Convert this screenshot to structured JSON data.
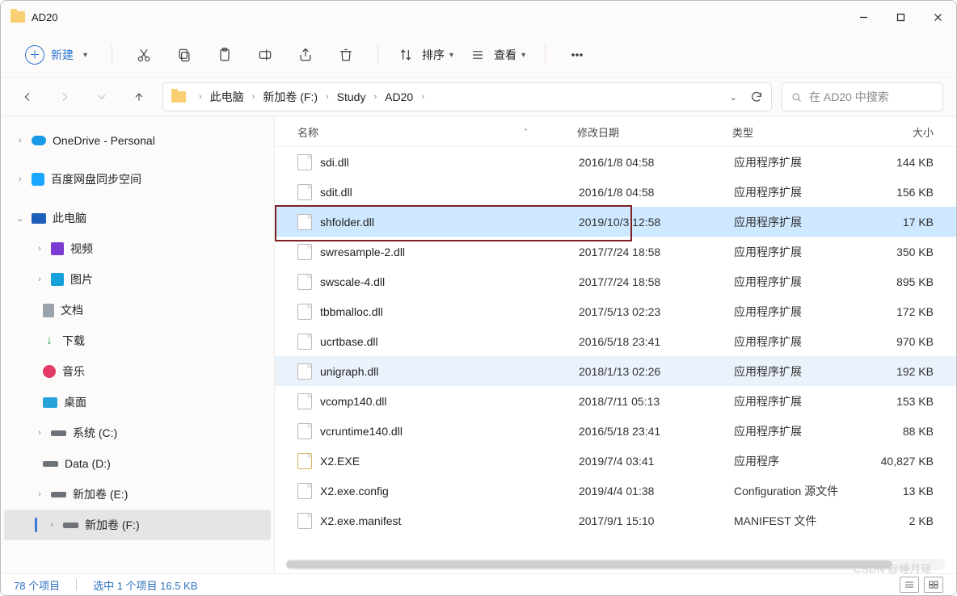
{
  "window": {
    "title": "AD20"
  },
  "toolbar": {
    "new_label": "新建",
    "sort_label": "排序",
    "view_label": "查看"
  },
  "breadcrumb": {
    "items": [
      "此电脑",
      "新加卷 (F:)",
      "Study",
      "AD20"
    ]
  },
  "search": {
    "placeholder": "在 AD20 中搜索"
  },
  "sidebar": {
    "onedrive": "OneDrive - Personal",
    "baidu": "百度网盘同步空间",
    "thispc": "此电脑",
    "video": "视频",
    "picture": "图片",
    "document": "文档",
    "download": "下载",
    "music": "音乐",
    "desktop": "桌面",
    "drive_c": "系统 (C:)",
    "drive_d": "Data (D:)",
    "drive_e": "新加卷 (E:)",
    "drive_f": "新加卷 (F:)"
  },
  "columns": {
    "name": "名称",
    "date": "修改日期",
    "type": "类型",
    "size": "大小"
  },
  "files": [
    {
      "name": "sdi.dll",
      "date": "2016/1/8 04:58",
      "type": "应用程序扩展",
      "size": "144 KB",
      "icon": "dll"
    },
    {
      "name": "sdit.dll",
      "date": "2016/1/8 04:58",
      "type": "应用程序扩展",
      "size": "156 KB",
      "icon": "dll"
    },
    {
      "name": "shfolder.dll",
      "date": "2019/10/3 12:58",
      "type": "应用程序扩展",
      "size": "17 KB",
      "icon": "dll",
      "selected": true,
      "boxed": true
    },
    {
      "name": "swresample-2.dll",
      "date": "2017/7/24 18:58",
      "type": "应用程序扩展",
      "size": "350 KB",
      "icon": "dll"
    },
    {
      "name": "swscale-4.dll",
      "date": "2017/7/24 18:58",
      "type": "应用程序扩展",
      "size": "895 KB",
      "icon": "dll"
    },
    {
      "name": "tbbmalloc.dll",
      "date": "2017/5/13 02:23",
      "type": "应用程序扩展",
      "size": "172 KB",
      "icon": "dll"
    },
    {
      "name": "ucrtbase.dll",
      "date": "2016/5/18 23:41",
      "type": "应用程序扩展",
      "size": "970 KB",
      "icon": "dll"
    },
    {
      "name": "unigraph.dll",
      "date": "2018/1/13 02:26",
      "type": "应用程序扩展",
      "size": "192 KB",
      "icon": "dll",
      "hover": true
    },
    {
      "name": "vcomp140.dll",
      "date": "2018/7/11 05:13",
      "type": "应用程序扩展",
      "size": "153 KB",
      "icon": "dll"
    },
    {
      "name": "vcruntime140.dll",
      "date": "2016/5/18 23:41",
      "type": "应用程序扩展",
      "size": "88 KB",
      "icon": "dll"
    },
    {
      "name": "X2.EXE",
      "date": "2019/7/4 03:41",
      "type": "应用程序",
      "size": "40,827 KB",
      "icon": "exe"
    },
    {
      "name": "X2.exe.config",
      "date": "2019/4/4 01:38",
      "type": "Configuration 源文件",
      "size": "13 KB",
      "icon": "cfg"
    },
    {
      "name": "X2.exe.manifest",
      "date": "2017/9/1 15:10",
      "type": "MANIFEST 文件",
      "size": "2 KB",
      "icon": "cfg"
    }
  ],
  "status": {
    "count": "78 个项目",
    "selection": "选中 1 个项目 16.5 KB"
  },
  "watermark": "CSDN @睡月瑶"
}
